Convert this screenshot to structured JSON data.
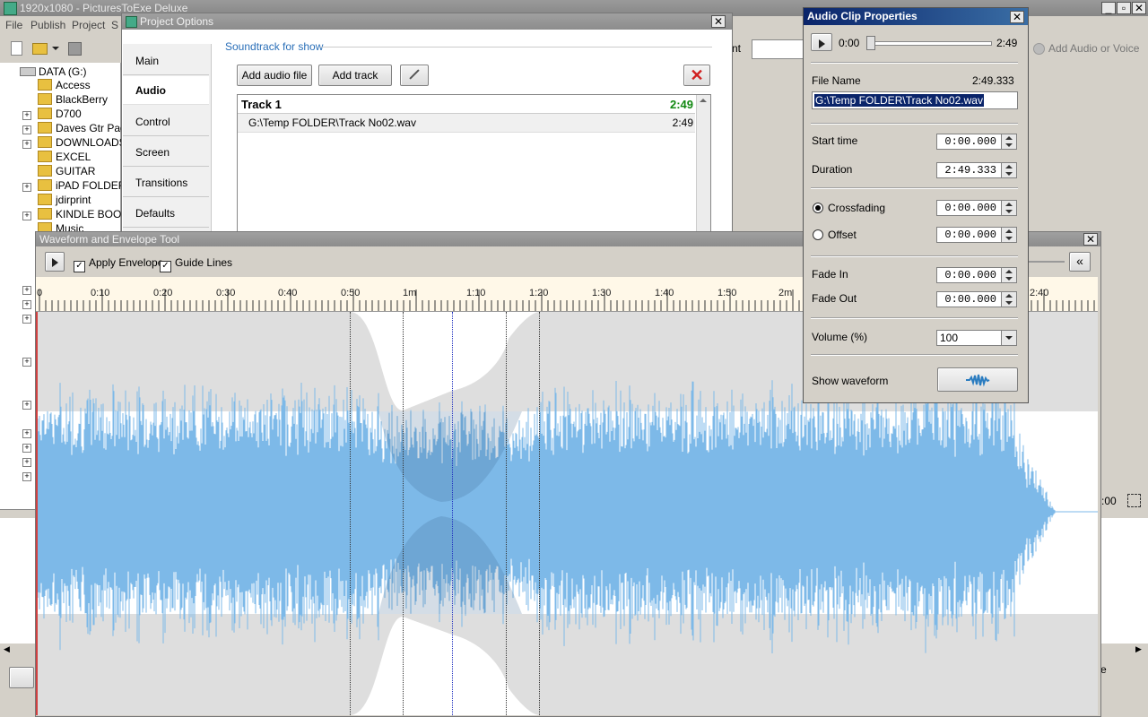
{
  "main_window": {
    "title": "1920x1080 - PicturesToExe Deluxe",
    "menu": [
      "File",
      "Publish",
      "Project",
      "S"
    ],
    "right_toolbar": {
      "partial_label": "nt",
      "add_audio_label": "Add Audio or Voice",
      "time_partial": ":00"
    },
    "bottom_right_partial": "e"
  },
  "tree": {
    "root": "DATA (G:)",
    "items": [
      "Access",
      "BlackBerry",
      "D700",
      "Daves Gtr Pag",
      "DOWNLOADS",
      "EXCEL",
      "GUITAR",
      "iPAD FOLDER",
      "jdirprint",
      "KINDLE BOOK",
      "Music"
    ]
  },
  "project_options": {
    "title": "Project Options",
    "tabs": [
      "Main",
      "Audio",
      "Control",
      "Screen",
      "Transitions",
      "Defaults"
    ],
    "active_tab": "Audio",
    "section_label": "Soundtrack for show",
    "add_audio_label": "Add audio file",
    "add_track_label": "Add track",
    "track": {
      "name": "Track 1",
      "duration": "2:49"
    },
    "file": {
      "path": "G:\\Temp FOLDER\\Track No02.wav",
      "duration": "2:49"
    }
  },
  "waveform_tool": {
    "title": "Waveform and Envelope Tool",
    "apply_envelope_label": "Apply Envelope",
    "apply_envelope_checked": true,
    "guide_lines_label": "Guide Lines",
    "guide_lines_checked": true,
    "collapse_label": "«",
    "ruler_ticks": [
      "0",
      "0:10",
      "0:20",
      "0:30",
      "0:40",
      "0:50",
      "1m",
      "1:10",
      "1:20",
      "1:30",
      "1:40",
      "1:50",
      "2m",
      "2:40"
    ],
    "waveform_color": "#7db9e8"
  },
  "clip_properties": {
    "title": "Audio Clip Properties",
    "time_start": "0:00",
    "time_end": "2:49",
    "file_name_label": "File Name",
    "file_duration": "2:49.333",
    "file_path": "G:\\Temp FOLDER\\Track No02.wav",
    "start_time_label": "Start time",
    "start_time": "0:00.000",
    "duration_label": "Duration",
    "duration": "2:49.333",
    "crossfading_label": "Crossfading",
    "crossfading_value": "0:00.000",
    "offset_label": "Offset",
    "offset_value": "0:00.000",
    "fade_in_label": "Fade In",
    "fade_in": "0:00.000",
    "fade_out_label": "Fade Out",
    "fade_out": "0:00.000",
    "volume_label": "Volume (%)",
    "volume": "100",
    "show_waveform_label": "Show waveform"
  }
}
